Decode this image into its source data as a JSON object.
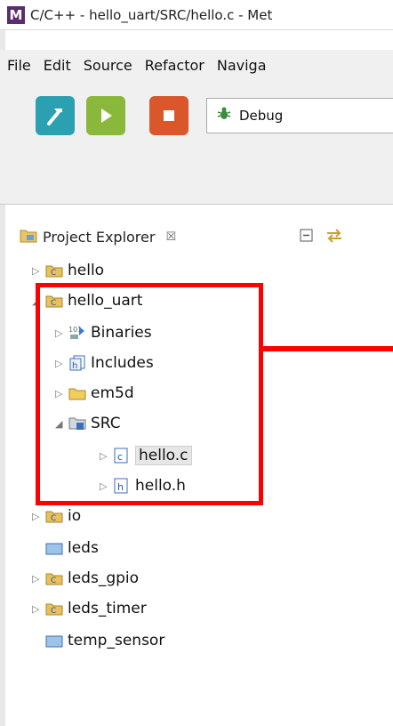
{
  "window": {
    "logo": "M",
    "title": "C/C++ - hello_uart/SRC/hello.c - Met"
  },
  "menu": [
    "File",
    "Edit",
    "Source",
    "Refactor",
    "Naviga"
  ],
  "toolbar": {
    "build_icon": "hammer-icon",
    "run_icon": "play-icon",
    "stop_icon": "stop-icon",
    "config_label": "Debug"
  },
  "panel": {
    "title": "Project Explorer",
    "close": "☒"
  },
  "tree": {
    "hello": "hello",
    "hello_uart": "hello_uart",
    "binaries": "Binaries",
    "includes": "Includes",
    "em5d": "em5d",
    "src": "SRC",
    "hello_c": "hello.c",
    "hello_h": "hello.h",
    "io": "io",
    "leds": "leds",
    "leds_gpio": "leds_gpio",
    "leds_timer": "leds_timer",
    "temp_sensor": "temp_sensor"
  },
  "colors": {
    "highlight": "#ff0000",
    "build": "#2aa0b0",
    "run": "#89b83a",
    "stop": "#d9572b"
  }
}
